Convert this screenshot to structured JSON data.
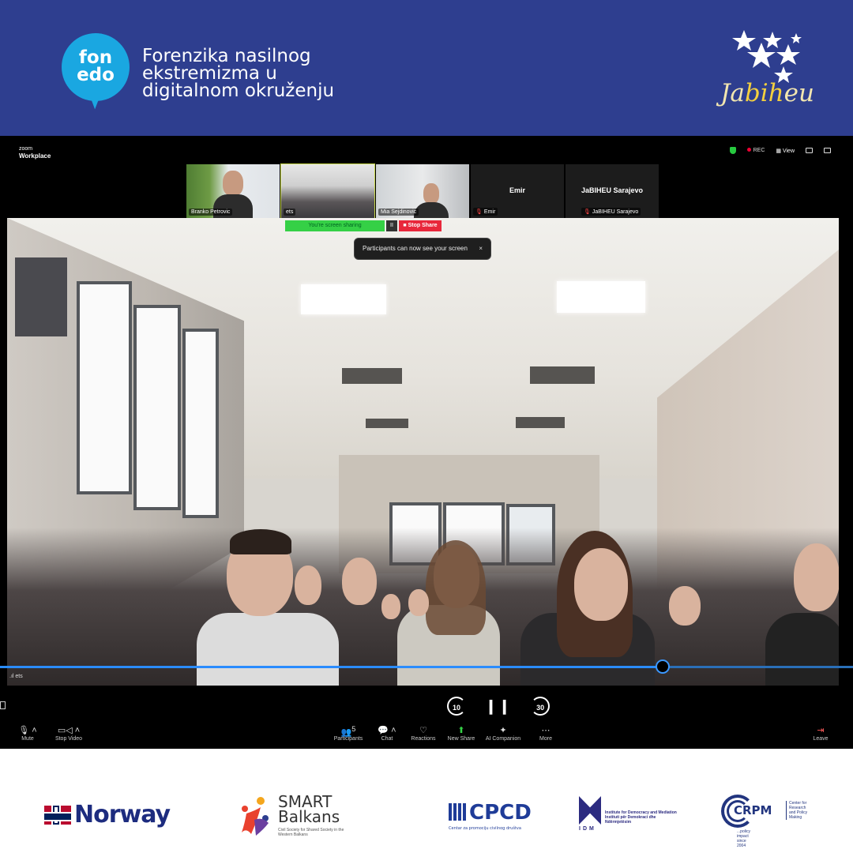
{
  "banner": {
    "fonedo_logo": "fon\nedo",
    "title": "Forenzika nasilnog\nekstremizma u\ndigitalnom okruženju",
    "jabiheu_logo": {
      "pre": "Ja",
      "mid": "bih",
      "post": "eu"
    },
    "colors": {
      "background": "#2e3e8f",
      "fonedo": "#1aa7e1",
      "jabiheu": "#f4d03f"
    }
  },
  "zoom": {
    "app_name": "zoom",
    "app_sub": "Workplace",
    "rec_label": "REC",
    "view_label": "View",
    "participants": [
      {
        "name": "Branko Petrovic",
        "video": true
      },
      {
        "name": "ets",
        "video": true,
        "active": true
      },
      {
        "name": "Mia Sejdinovic",
        "video": true
      },
      {
        "name": "Emir",
        "video": false,
        "muted": true
      },
      {
        "name": "JaBIHEU Sarajevo",
        "video": false,
        "muted": true
      }
    ],
    "share_status": "You're screen sharing",
    "pause_glyph": "II",
    "stop_share": "Stop Share",
    "notice": "Participants can now see your screen",
    "notice_close": "×",
    "video_label": ".ıl ets",
    "playback": {
      "rewind": "10",
      "forward": "30",
      "progress": 0.778
    },
    "toolbar": [
      {
        "id": "mute",
        "label": "Mute",
        "icon": "mic-icon"
      },
      {
        "id": "stop-video",
        "label": "Stop Video",
        "icon": "camera-icon"
      },
      {
        "id": "participants",
        "label": "Participants",
        "icon": "people-icon",
        "count": "5"
      },
      {
        "id": "chat",
        "label": "Chat",
        "icon": "chat-icon"
      },
      {
        "id": "reactions",
        "label": "Reactions",
        "icon": "heart-icon"
      },
      {
        "id": "new-share",
        "label": "New Share",
        "icon": "share-icon"
      },
      {
        "id": "ai-companion",
        "label": "AI Companion",
        "icon": "sparkle-icon"
      },
      {
        "id": "more",
        "label": "More",
        "icon": "more-icon"
      },
      {
        "id": "leave",
        "label": "Leave",
        "icon": "leave-icon"
      }
    ],
    "colors": {
      "accent": "#2a8cff",
      "sharing": "#35d046",
      "stop": "#e8273b"
    }
  },
  "partners": {
    "norway": "Norway",
    "smart_balkans": {
      "name": "SMART\nBalkans",
      "sub": "Civil Society for Shared Society in the Western Balkans"
    },
    "cpcd": {
      "name": "CPCD",
      "sub": "Centar za promociju civilnog društva"
    },
    "idm": {
      "letters": "IDM",
      "text": "Institute for Democracy and Mediation\nInstituti për Demokraci dhe Ndërmjetësim"
    },
    "crpm": {
      "name": "CRPM",
      "side": "Center for Research and Policy Making",
      "tag": "...policy impact since 2004"
    }
  }
}
